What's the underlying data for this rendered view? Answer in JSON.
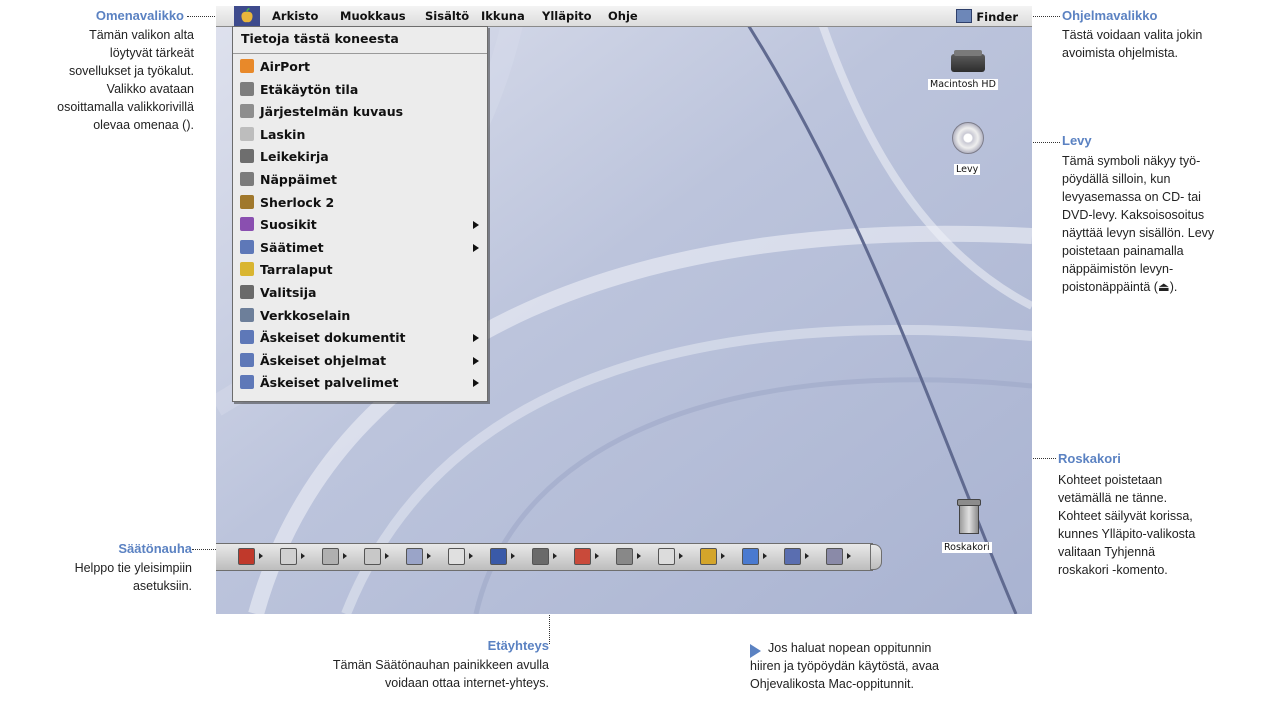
{
  "annotations": {
    "apple_menu": {
      "title": "Omenavalikko",
      "lines": [
        "Tämän valikon alta",
        "löytyvät tärkeät",
        "sovellukset ja työkalut.",
        "Valikko avataan",
        "osoittamalla valikkorivillä",
        "olevaa omenaa ()."
      ]
    },
    "app_menu": {
      "title": "Ohjelmavalikko",
      "lines": [
        "Tästä voidaan valita jokin",
        "avoimista ohjelmista."
      ]
    },
    "disk": {
      "title": "Levy",
      "lines": [
        "Tämä symboli näkyy työ-",
        "pöydällä silloin, kun",
        "levyasemassa on CD- tai",
        "DVD-levy. Kaksoisosoitus",
        "näyttää levyn sisällön. Levy",
        "poistetaan painamalla",
        "näppäimistön levyn-",
        "poistonäppäintä (⏏)."
      ]
    },
    "trash": {
      "title": "Roskakori",
      "lines": [
        "Kohteet poistetaan",
        "vetämällä ne tänne.",
        "Kohteet säilyvät korissa,",
        "kunnes Ylläpito-valikosta",
        "valitaan Tyhjennä",
        "roskakori -komento."
      ]
    },
    "control_strip": {
      "title": "Säätönauha",
      "lines": [
        "Helppo tie yleisimpiin",
        "asetuksiin."
      ]
    },
    "remote": {
      "title": "Etäyhteys",
      "lines": [
        "Tämän Säätönauhan painikkeen avulla",
        "voidaan ottaa internet-yhteys."
      ]
    },
    "tip": {
      "lines": [
        "Jos haluat nopean oppitunnin",
        "hiiren ja työpöydän käytöstä, avaa",
        "Ohjevalikosta Mac-oppitunnit."
      ]
    }
  },
  "menubar": {
    "menus": [
      "Arkisto",
      "Muokkaus",
      "Sisältö",
      "Ikkuna",
      "Ylläpito",
      "Ohje"
    ],
    "app_label": "Finder"
  },
  "apple_menu": {
    "about": "Tietoja tästä koneesta",
    "items": [
      {
        "label": "AirPort",
        "icon": "airport-icon",
        "color": "#e8892a",
        "submenu": false
      },
      {
        "label": "Etäkäytön tila",
        "icon": "remote-access-icon",
        "color": "#7d7d7d",
        "submenu": false
      },
      {
        "label": "Järjestelmän kuvaus",
        "icon": "system-profiler-icon",
        "color": "#8e8e8e",
        "submenu": false
      },
      {
        "label": "Laskin",
        "icon": "calculator-icon",
        "color": "#bdbdbd",
        "submenu": false
      },
      {
        "label": "Leikekirja",
        "icon": "scrapbook-icon",
        "color": "#6e6e6e",
        "submenu": false
      },
      {
        "label": "Näppäimet",
        "icon": "keycaps-icon",
        "color": "#7b7b7b",
        "submenu": false
      },
      {
        "label": "Sherlock 2",
        "icon": "sherlock-icon",
        "color": "#a0782c",
        "submenu": false
      },
      {
        "label": "Suosikit",
        "icon": "favorites-icon",
        "color": "#8a4fb0",
        "submenu": true
      },
      {
        "label": "Säätimet",
        "icon": "control-panels-icon",
        "color": "#5e78b8",
        "submenu": true
      },
      {
        "label": "Tarralaput",
        "icon": "stickies-icon",
        "color": "#d9b530",
        "submenu": false
      },
      {
        "label": "Valitsija",
        "icon": "chooser-icon",
        "color": "#6a6a6a",
        "submenu": false
      },
      {
        "label": "Verkkoselain",
        "icon": "network-browser-icon",
        "color": "#6d7f9a",
        "submenu": false
      },
      {
        "label": "Äskeiset dokumentit",
        "icon": "recent-documents-icon",
        "color": "#5e78b8",
        "submenu": true
      },
      {
        "label": "Äskeiset ohjelmat",
        "icon": "recent-applications-icon",
        "color": "#5e78b8",
        "submenu": true
      },
      {
        "label": "Äskeiset palvelimet",
        "icon": "recent-servers-icon",
        "color": "#5e78b8",
        "submenu": true
      }
    ]
  },
  "desktop": {
    "hd_label": "Macintosh HD",
    "disk_label": "Levy",
    "trash_label": "Roskakori"
  },
  "colors": {
    "accent": "#5b82c2",
    "wallpaper": "#c4cbe0"
  }
}
